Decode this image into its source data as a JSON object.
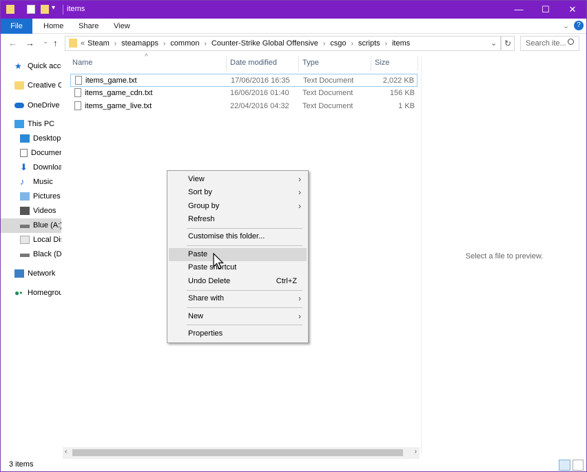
{
  "window": {
    "title": "items",
    "minimize": "—",
    "maximize": "☐",
    "close": "✕",
    "help": "?"
  },
  "ribbon": {
    "file": "File",
    "tabs": [
      "Home",
      "Share",
      "View"
    ],
    "expand": "⌄"
  },
  "address": {
    "overflow": "«",
    "crumbs": [
      "Steam",
      "steamapps",
      "common",
      "Counter-Strike Global Offensive",
      "csgo",
      "scripts",
      "items"
    ],
    "refresh": "↻",
    "dropdown": "⌄"
  },
  "search": {
    "placeholder": "Search ite..."
  },
  "nav_buttons": {
    "back": "←",
    "forward": "→",
    "recent": "⌄",
    "up": "↑"
  },
  "sidebar": {
    "items": [
      {
        "label": "Quick access",
        "icon": "star-icon"
      },
      {
        "label": "Creative Cloud Files",
        "icon": "creative-cloud-icon"
      },
      {
        "label": "OneDrive",
        "icon": "cloud-icon"
      },
      {
        "label": "This PC",
        "icon": "computer-icon"
      },
      {
        "label": "Desktop",
        "icon": "desktop-icon"
      },
      {
        "label": "Documents",
        "icon": "document-icon"
      },
      {
        "label": "Downloads",
        "icon": "download-icon"
      },
      {
        "label": "Music",
        "icon": "music-icon"
      },
      {
        "label": "Pictures",
        "icon": "picture-icon"
      },
      {
        "label": "Videos",
        "icon": "video-icon"
      },
      {
        "label": "Blue (A:)",
        "icon": "drive-icon"
      },
      {
        "label": "Local Disk",
        "icon": "drive-icon"
      },
      {
        "label": "Black (D:)",
        "icon": "drive-icon"
      },
      {
        "label": "Network",
        "icon": "network-icon"
      },
      {
        "label": "Homegroup",
        "icon": "homegroup-icon"
      }
    ]
  },
  "columns": {
    "name": "Name",
    "date": "Date modified",
    "type": "Type",
    "size": "Size",
    "sort_arrow": "^"
  },
  "files": [
    {
      "name": "items_game.txt",
      "date": "17/06/2016 16:35",
      "type": "Text Document",
      "size": "2,022 KB"
    },
    {
      "name": "items_game_cdn.txt",
      "date": "16/06/2016 01:40",
      "type": "Text Document",
      "size": "156 KB"
    },
    {
      "name": "items_game_live.txt",
      "date": "22/04/2016 04:32",
      "type": "Text Document",
      "size": "1 KB"
    }
  ],
  "preview": {
    "text": "Select a file to preview."
  },
  "status": {
    "count": "3 items"
  },
  "context_menu": {
    "view": "View",
    "sort_by": "Sort by",
    "group_by": "Group by",
    "refresh": "Refresh",
    "customise": "Customise this folder...",
    "paste": "Paste",
    "paste_shortcut": "Paste shortcut",
    "undo_delete": "Undo Delete",
    "undo_shortcut": "Ctrl+Z",
    "share_with": "Share with",
    "new": "New",
    "properties": "Properties",
    "chevron": "›"
  },
  "colors": {
    "titlebar": "#7b1fc4",
    "file_tab": "#1a6fd1",
    "selection_border": "#99c9ef"
  }
}
